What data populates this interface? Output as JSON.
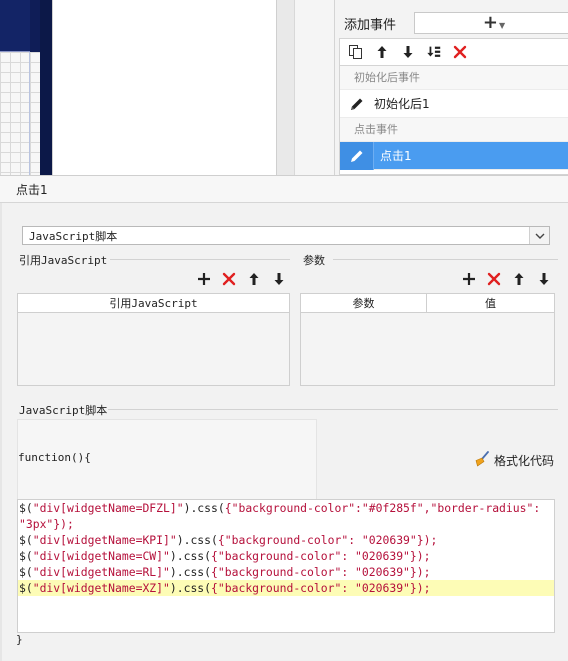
{
  "event_panel": {
    "add_event_label": "添加事件",
    "add_event_button": "+",
    "toolbar_icons": [
      "copy-icon",
      "arrow-up-icon",
      "arrow-down-icon",
      "move-bottom-icon",
      "delete-icon"
    ],
    "groups": [
      {
        "label": "初始化后事件",
        "items": [
          {
            "label": "初始化后1",
            "selected": false
          }
        ]
      },
      {
        "label": "点击事件",
        "items": [
          {
            "label": "点击1",
            "selected": true
          }
        ]
      }
    ]
  },
  "dialog": {
    "title": "点击1",
    "type_select": {
      "value": "JavaScript脚本"
    },
    "ref_js": {
      "title": "引用JavaScript",
      "column": "引用JavaScript",
      "icons": [
        "add-icon",
        "delete-icon",
        "arrow-up-icon",
        "arrow-down-icon"
      ]
    },
    "params": {
      "title": "参数",
      "columns": [
        "参数",
        "值"
      ],
      "icons": [
        "add-icon",
        "delete-icon",
        "arrow-up-icon",
        "arrow-down-icon"
      ]
    },
    "script": {
      "title": "JavaScript脚本",
      "func_open": "function(){",
      "format_button": "格式化代码",
      "func_close": "}",
      "lines": [
        {
          "sel": "\"div[widgetName=DFZL]\"",
          "css": "{\"background-color\":\"#0f285f\",\"border-radius\":",
          "tail": ""
        },
        {
          "sel": "",
          "css": "\"3px\"});",
          "tail": ""
        },
        {
          "sel": "\"div[widgetName=KPI]\"",
          "css": "{\"background-color\": \"020639\"}",
          "tail": ");"
        },
        {
          "sel": "\"div[widgetName=CW]\"",
          "css": "{\"background-color\": \"020639\"}",
          "tail": ");"
        },
        {
          "sel": "\"div[widgetName=RL]\"",
          "css": "{\"background-color\": \"020639\"}",
          "tail": ");"
        },
        {
          "sel": "\"div[widgetName=XZ]\"",
          "css": "{\"background-color\": \"020639\"}",
          "tail": ");"
        }
      ],
      "highlighted_line": 5
    }
  },
  "colors": {
    "selection": "#4a9cf0",
    "delete_red": "#e02020",
    "code_string": "#b5103b",
    "current_line": "#fdfcb6",
    "designer_navy": "#0f1d57"
  }
}
